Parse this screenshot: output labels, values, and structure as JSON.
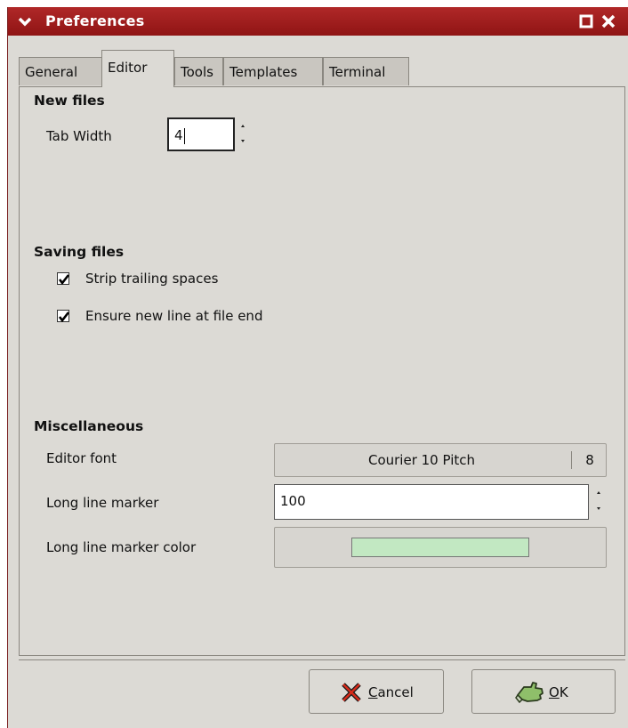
{
  "window": {
    "title": "Preferences"
  },
  "tabs": [
    {
      "label": "General"
    },
    {
      "label": "Editor",
      "active": true
    },
    {
      "label": "Tools"
    },
    {
      "label": "Templates"
    },
    {
      "label": "Terminal"
    }
  ],
  "new_files": {
    "heading": "New files",
    "tab_width_label": "Tab Width",
    "tab_width_value": "4"
  },
  "saving_files": {
    "heading": "Saving files",
    "strip_trailing_label": "Strip trailing spaces",
    "strip_trailing_checked": true,
    "ensure_newline_label": "Ensure new line at file end",
    "ensure_newline_checked": true
  },
  "misc": {
    "heading": "Miscellaneous",
    "editor_font_label": "Editor font",
    "editor_font_name": "Courier 10 Pitch",
    "editor_font_size": "8",
    "long_line_marker_label": "Long line marker",
    "long_line_marker_value": "100",
    "long_line_color_label": "Long line marker color",
    "long_line_color": "#c2e8c2"
  },
  "buttons": {
    "cancel_underlined": "C",
    "cancel_rest": "ancel",
    "ok_underlined": "O",
    "ok_rest": "K"
  },
  "colors": {
    "titlebar": "#a01e1e",
    "background": "#dcdad5"
  },
  "icons": {
    "window_menu": "chevron-down-icon",
    "maximize": "maximize-icon",
    "close": "close-icon",
    "cancel": "cancel-x-icon",
    "ok": "ok-hand-icon"
  }
}
